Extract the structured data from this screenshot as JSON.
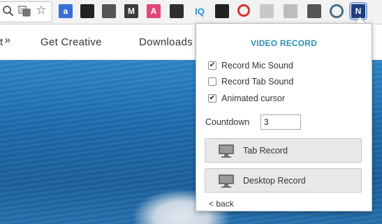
{
  "toolbar": {
    "omnibox_icons": [
      "search-zoom-icon",
      "translate-icon",
      "star-bookmark-icon"
    ],
    "extension_icons": [
      {
        "name": "extension-a-icon",
        "text": "a",
        "color": "#3a6fd8"
      },
      {
        "name": "extension-cat-icon",
        "text": "",
        "color": "#222222"
      },
      {
        "name": "extension-wizard-icon",
        "text": "",
        "color": "#555555"
      },
      {
        "name": "extension-m-icon",
        "text": "M",
        "color": "#3b3b3b"
      },
      {
        "name": "extension-a-pink-icon",
        "text": "A",
        "color": "#e5447b"
      },
      {
        "name": "extension-checklist-icon",
        "text": "",
        "color": "#2e2e2e"
      },
      {
        "name": "extension-iq-icon",
        "text": "IQ",
        "color": "#2a8fd9"
      },
      {
        "name": "extension-hat-icon",
        "text": "",
        "color": "#222222"
      },
      {
        "name": "extension-block-icon",
        "text": "",
        "color": "#d9342b"
      },
      {
        "name": "extension-layout-icon",
        "text": "",
        "color": "#c8c8c8"
      },
      {
        "name": "extension-window-icon",
        "text": "",
        "color": "#bdbdbd"
      },
      {
        "name": "extension-cast-icon",
        "text": "",
        "color": "#555555"
      },
      {
        "name": "extension-spiral-icon",
        "text": "",
        "color": "#4a6d86"
      },
      {
        "name": "extension-n-video-icon",
        "text": "N",
        "color": "#1e3d7a"
      }
    ]
  },
  "site_nav": {
    "partial_item": "t",
    "partial_arrow": "»",
    "items": [
      "Get Creative",
      "Downloads"
    ]
  },
  "popup": {
    "title": "VIDEO RECORD",
    "options": [
      {
        "label": "Record Mic Sound",
        "checked": true
      },
      {
        "label": "Record Tab Sound",
        "checked": false
      },
      {
        "label": "Animated cursor",
        "checked": true
      }
    ],
    "countdown": {
      "label": "Countdown",
      "value": "3"
    },
    "buttons": {
      "tab_record": "Tab Record",
      "desktop_record": "Desktop Record"
    },
    "back_link": "< back"
  },
  "colors": {
    "accent": "#2c91b0",
    "ocean": "#1d6aab"
  }
}
